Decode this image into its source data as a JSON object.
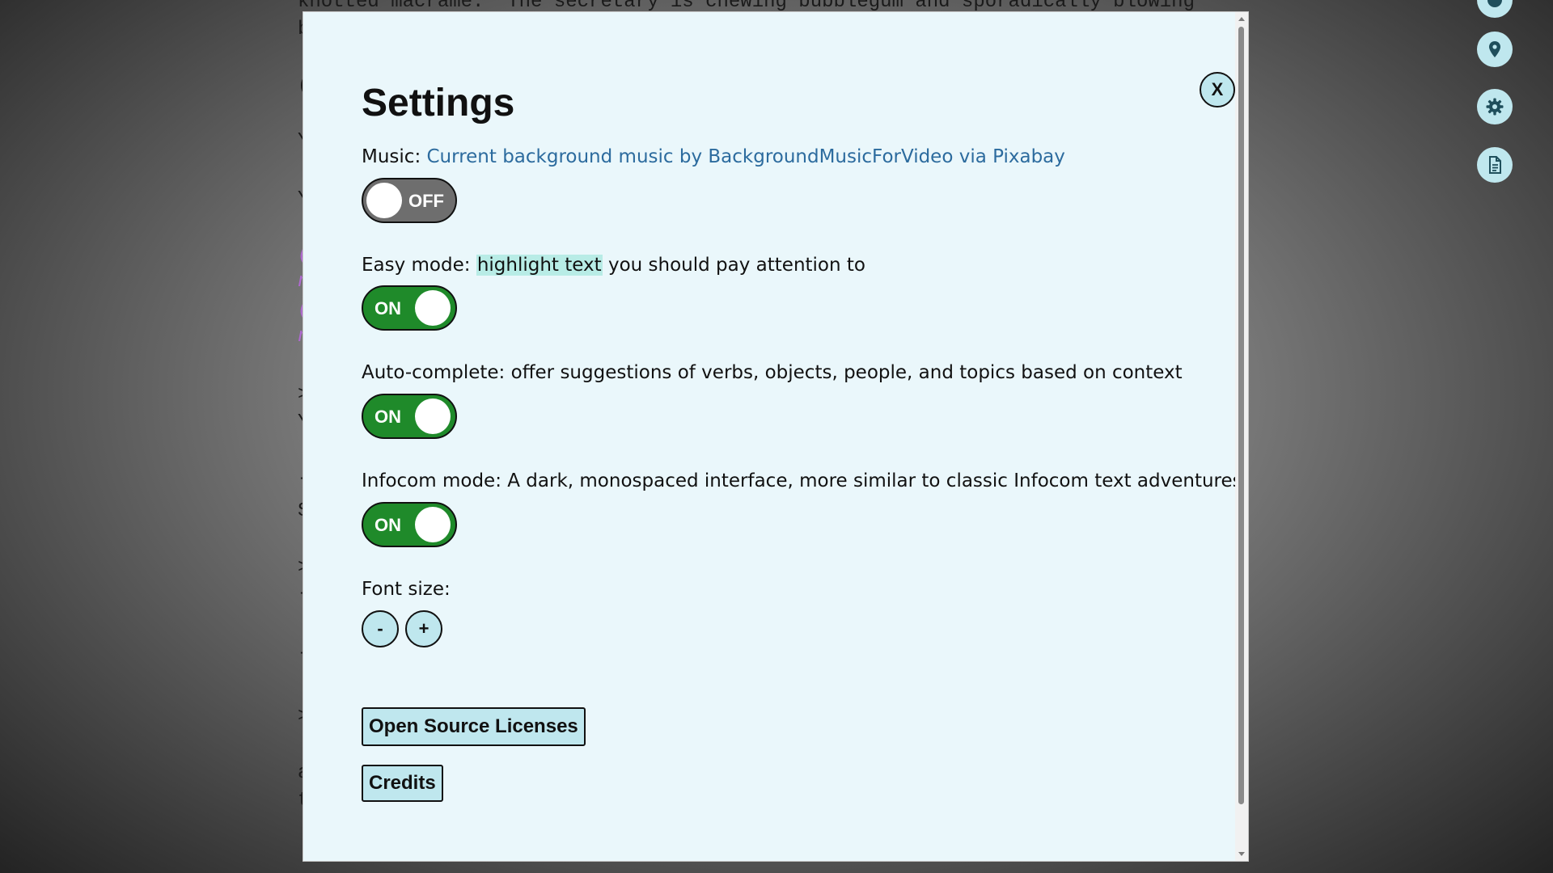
{
  "background": {
    "story_line_1": "knotted macramé.  The secretary is chewing bubblegum and sporadically blowing",
    "story_line_2": "b",
    "fragments": [
      "(",
      "Y",
      "Y",
      "(",
      "n",
      "(",
      "n",
      ">",
      "Y",
      "-",
      "S",
      ">",
      "-",
      "-",
      ">",
      "a",
      "t"
    ]
  },
  "side_icons": [
    "compass-icon",
    "location-pin-icon",
    "gear-icon",
    "document-icon"
  ],
  "settings": {
    "title": "Settings",
    "close_label": "X",
    "music": {
      "label": "Music: ",
      "link_text": "Current background music by BackgroundMusicForVideo via Pixabay",
      "state": "OFF"
    },
    "easy_mode": {
      "prefix": "Easy mode: ",
      "highlight": "highlight text",
      "suffix": " you should pay attention to",
      "state": "ON"
    },
    "auto_complete": {
      "label": "Auto-complete: offer suggestions of verbs, objects, people, and topics based on context",
      "state": "ON"
    },
    "infocom_mode": {
      "label": "Infocom mode: A dark, monospaced interface, more similar to classic Infocom text adventures.",
      "state": "ON"
    },
    "font_size": {
      "label": "Font size:",
      "decrease": "-",
      "increase": "+"
    },
    "licenses_button": "Open Source Licenses",
    "credits_button": "Credits"
  },
  "colors": {
    "modal_bg": "#eaf7fb",
    "toggle_on": "#1f8a2a",
    "toggle_off": "#6e6e6e",
    "accent_button": "#bfe7ee",
    "link": "#2c6b9e",
    "highlight": "#b8ece6"
  }
}
